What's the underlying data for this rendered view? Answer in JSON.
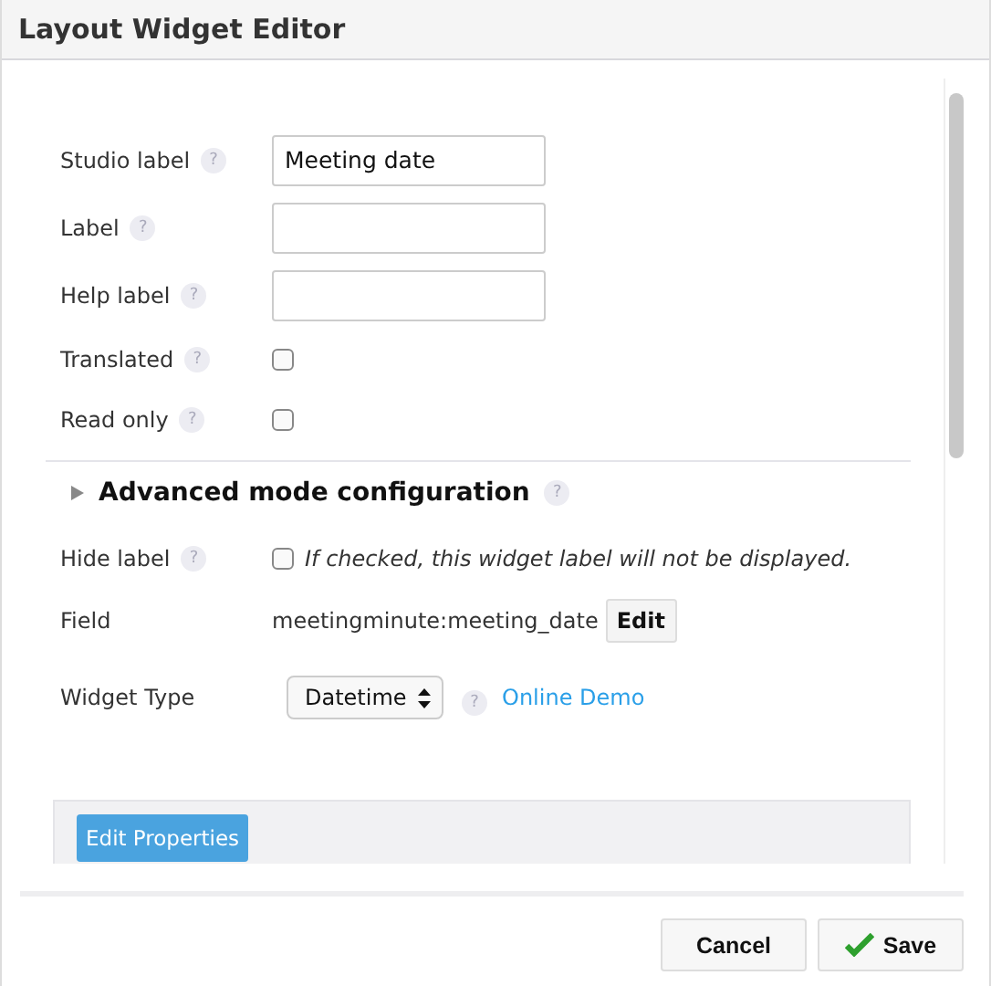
{
  "window": {
    "title": "Layout Widget Editor"
  },
  "fields": [
    {
      "kind": "text",
      "label": "Studio label",
      "help": "?",
      "value": "Meeting date"
    },
    {
      "kind": "text",
      "label": "Label",
      "help": "?"
    },
    {
      "kind": "text",
      "label": "Help label",
      "help": "?"
    },
    {
      "kind": "checkbox",
      "label": "Translated",
      "help": "?",
      "checked": false
    },
    {
      "kind": "checkbox",
      "label": "Read only",
      "help": "?",
      "checked": false
    }
  ],
  "advanced": {
    "title": "Advanced mode configuration",
    "help": "?",
    "expanded": false
  },
  "hide_label": {
    "label": "Hide label",
    "help": "?",
    "checked": false,
    "hint": "If checked, this widget label will not be displayed."
  },
  "field": {
    "label": "Field",
    "value": "meetingminute:meeting_date",
    "button": "Edit"
  },
  "widget_type": {
    "label": "Widget Type",
    "value": "Datetime",
    "help": "?",
    "link": "Online Demo"
  },
  "edit_properties": "Edit Properties",
  "buttons": [
    {
      "kind": "cancel",
      "label": "Cancel"
    },
    {
      "kind": "save",
      "label": "Save"
    }
  ]
}
